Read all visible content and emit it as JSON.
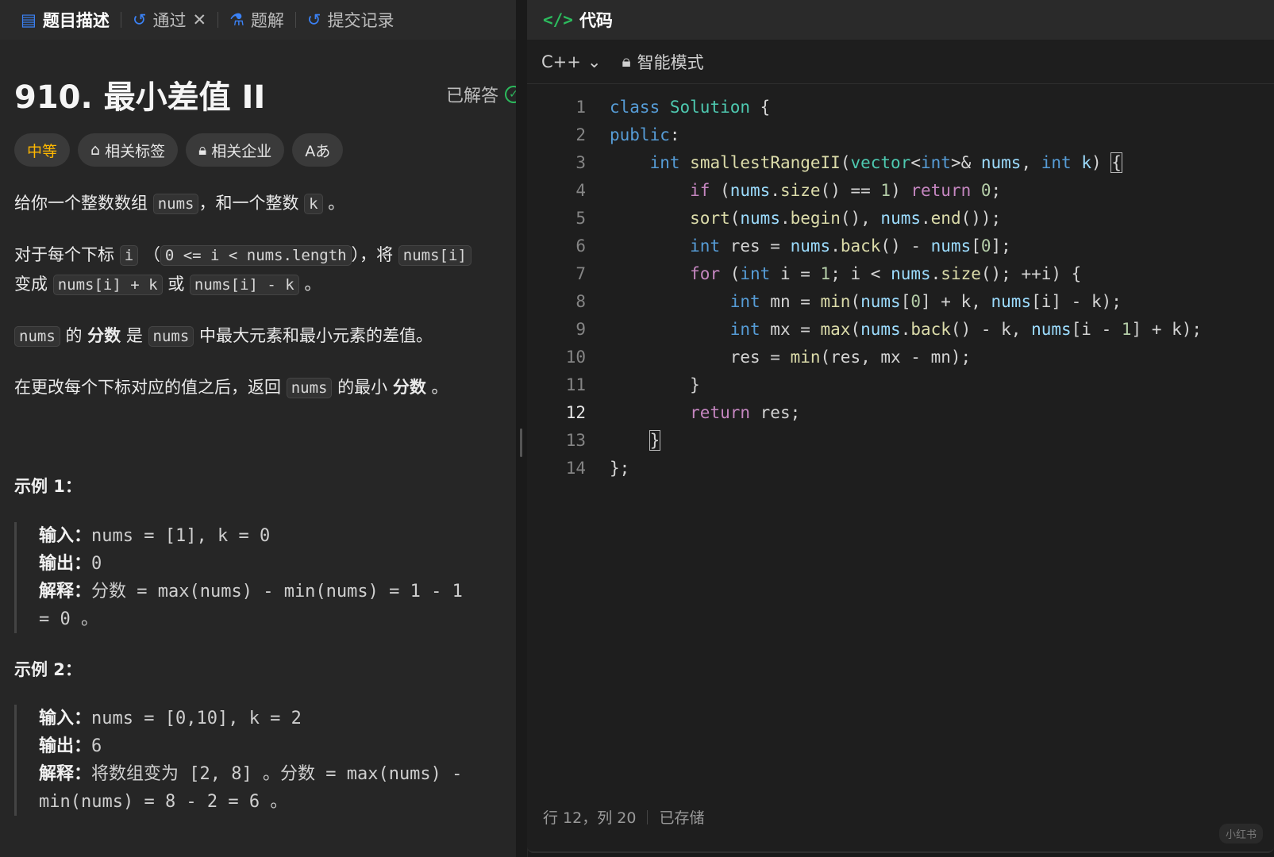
{
  "left_tabs": [
    {
      "label": "题目描述",
      "icon": "document-icon"
    },
    {
      "label": "通过",
      "icon": "history-icon"
    },
    {
      "label": "题解",
      "icon": "flask-icon"
    },
    {
      "label": "提交记录",
      "icon": "history-icon"
    }
  ],
  "close_glyph": "✕",
  "problem": {
    "title": "910. 最小差值 II",
    "status": "已解答",
    "difficulty": "中等",
    "chips": {
      "tags": "相关标签",
      "companies": "相关企业",
      "font": "Aあ"
    }
  },
  "desc": {
    "p1": {
      "a": "给你一个整数数组",
      "c1": "nums",
      "b": "，和一个整数",
      "c2": "k",
      "d": "。"
    },
    "p2": {
      "a": "对于每个下标",
      "c1": "i",
      "b": "（",
      "c2": "0 <= i < nums.length",
      "d": "），将",
      "c3": "nums[i]",
      "e": "变成",
      "c4": "nums[i] + k",
      "f": "或",
      "c5": "nums[i] - k",
      "g": "。"
    },
    "p3": {
      "c1": "nums",
      "a": "的",
      "b1": "分数",
      "b": "是",
      "c2": "nums",
      "d": "中最大元素和最小元素的差值。"
    },
    "p4": {
      "a": "在更改每个下标对应的值之后，返回",
      "c1": "nums",
      "b": "的最小",
      "b1": "分数",
      "d": "。"
    }
  },
  "examples": [
    {
      "title": "示例 1：",
      "input_label": "输入：",
      "input": "nums = [1], k = 0",
      "output_label": "输出：",
      "output": "0",
      "explain_label": "解释：",
      "explain1": "分数 = max(nums) - min(nums) = 1 - 1",
      "explain2": "= 0 。"
    },
    {
      "title": "示例 2：",
      "input_label": "输入：",
      "input": "nums = [0,10], k = 2",
      "output_label": "输出：",
      "output": "6",
      "explain_label": "解释：",
      "explain1": "将数组变为 [2, 8] 。分数 = max(nums) -",
      "explain2": "min(nums) = 8 - 2 = 6 。"
    }
  ],
  "editor": {
    "header": "代码",
    "language": "C++",
    "mode": "智能模式",
    "line_numbers": [
      "1",
      "2",
      "3",
      "4",
      "5",
      "6",
      "7",
      "8",
      "9",
      "10",
      "11",
      "12",
      "13",
      "14"
    ],
    "current_line": "12",
    "status_pos": "行 12，列 20",
    "status_saved": "已存储"
  },
  "watermark": "小红书"
}
